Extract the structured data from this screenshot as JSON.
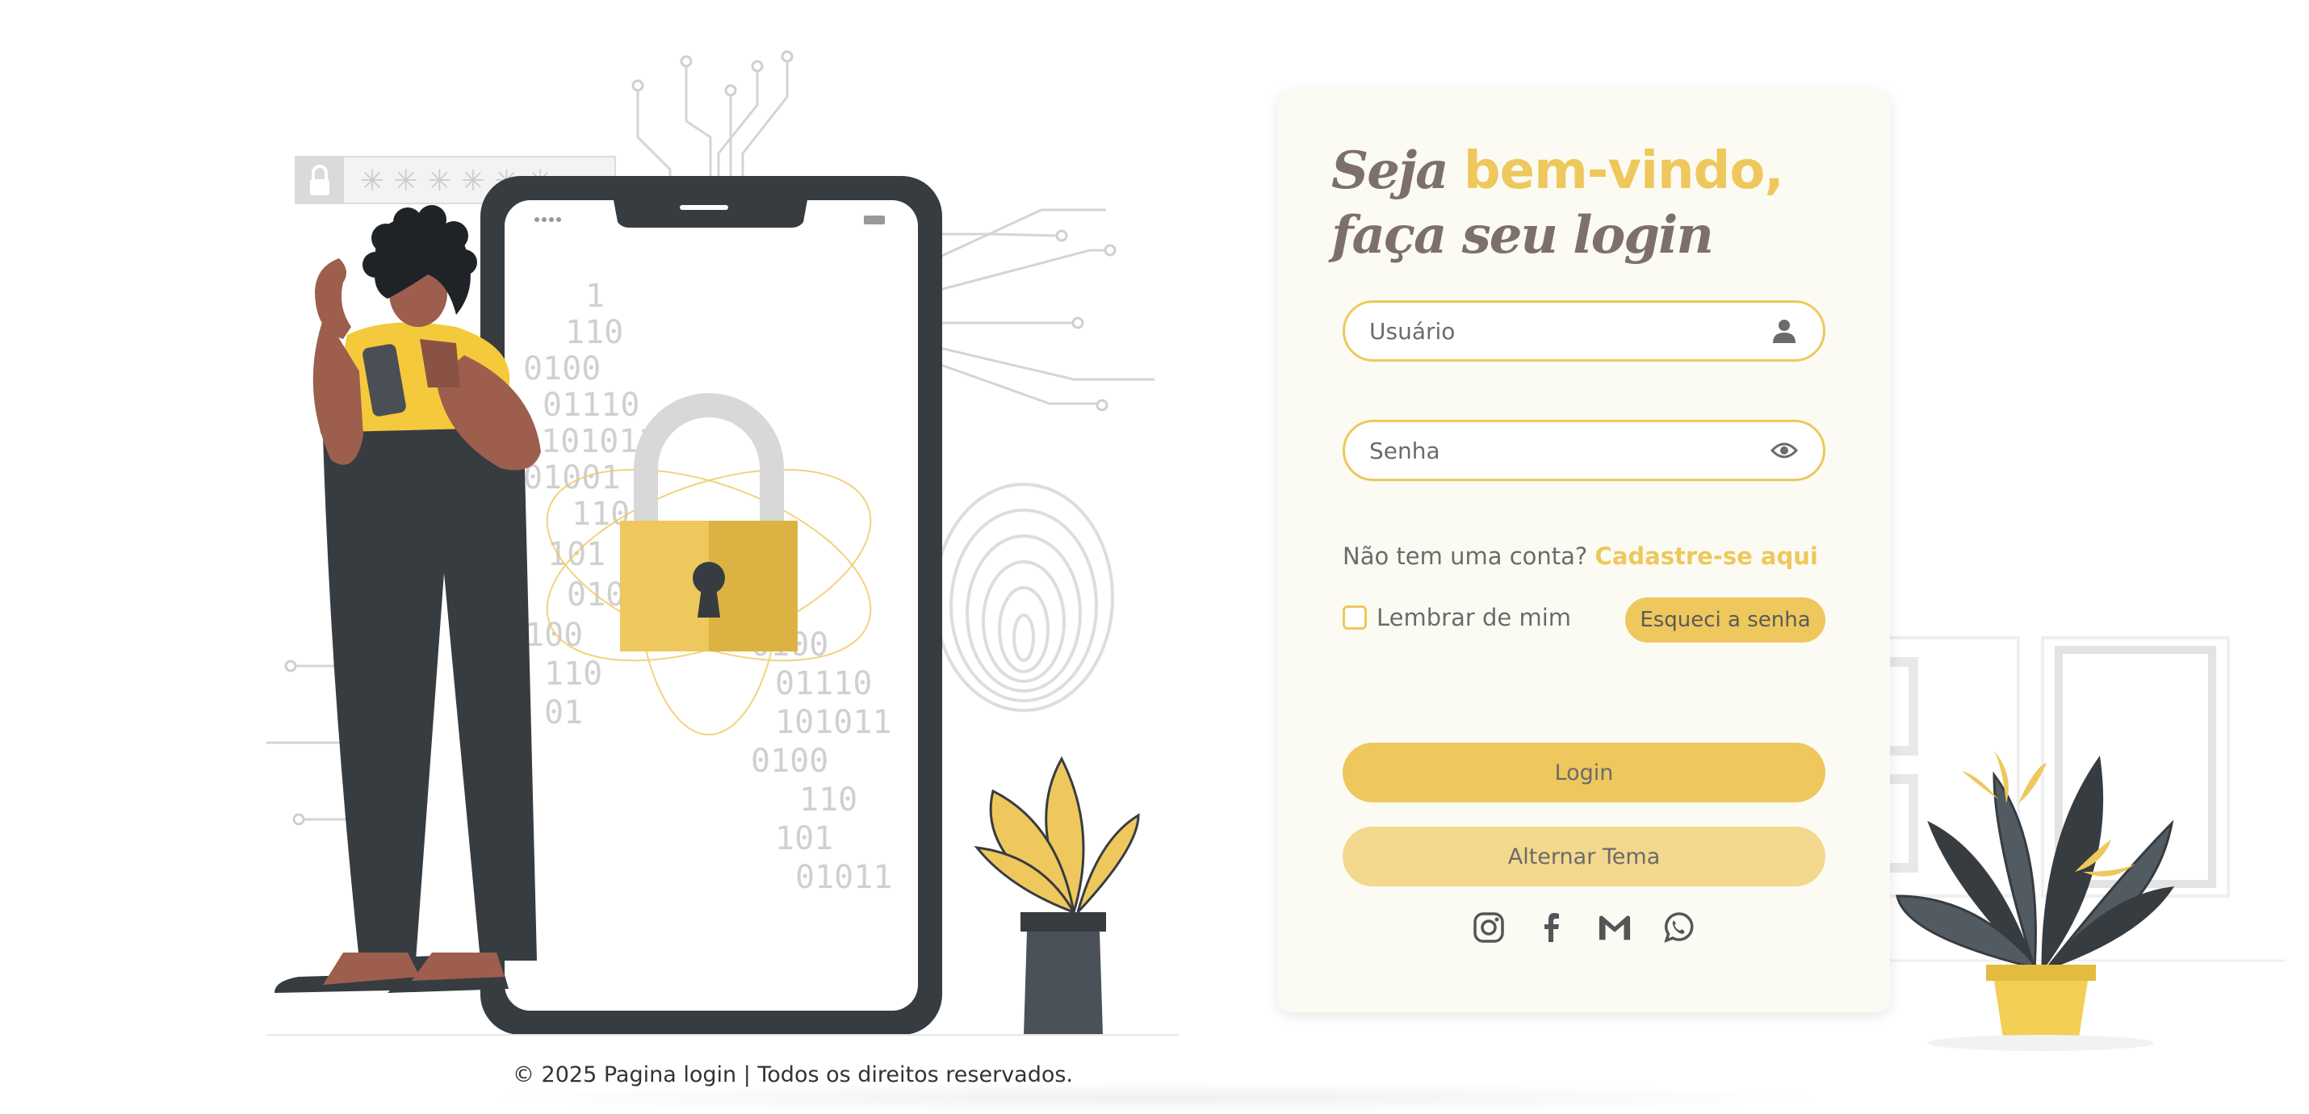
{
  "login": {
    "title_part1": "Seja",
    "title_accent": "bem-vindo,",
    "title_line2": "faça seu login",
    "username_placeholder": "Usuário",
    "password_placeholder": "Senha",
    "signup_text": "Não tem uma conta?",
    "signup_link": "Cadastre-se aqui",
    "remember_label": "Lembrar de mim",
    "forgot_label": "Esqueci a senha",
    "login_button": "Login",
    "theme_button": "Alternar Tema"
  },
  "socials": [
    "instagram-icon",
    "facebook-icon",
    "gmail-icon",
    "whatsapp-icon"
  ],
  "illustration": {
    "binary_left": [
      "1",
      "110",
      "0100",
      "01110",
      "101011",
      "01001",
      "110",
      "101",
      "010",
      "100",
      "110",
      "01"
    ],
    "binary_right": [
      "0100",
      "01110",
      "101011",
      "0100",
      "110",
      "101",
      "01011"
    ],
    "password_mask": "✳ ✳ ✳ ✳ ✳ ✳"
  },
  "footer": {
    "text": "© 2025 Pagina login | Todos os direitos reservados."
  },
  "colors": {
    "accent": "#eec85c",
    "card": "#fcfbf3",
    "dark": "#373c41",
    "text": "#6b6b6b"
  }
}
